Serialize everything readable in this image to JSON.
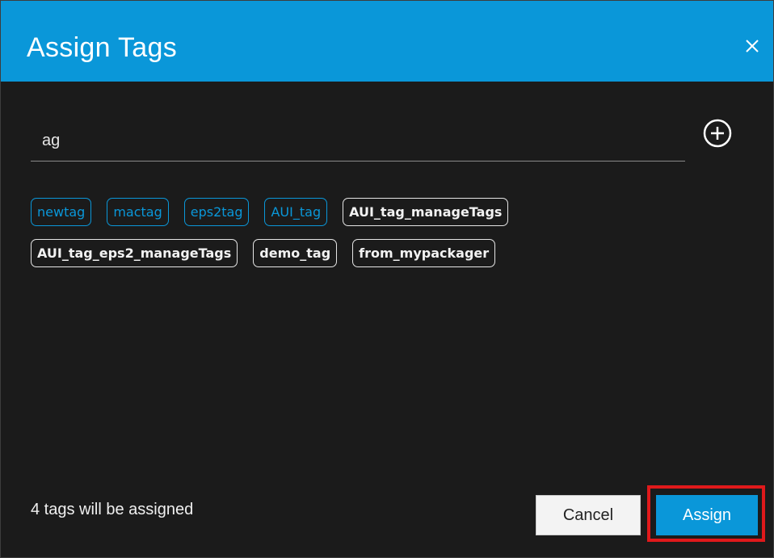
{
  "dialog": {
    "title": "Assign Tags",
    "close_icon": "close-icon"
  },
  "search": {
    "value": "ag",
    "add_icon": "plus-circle-icon"
  },
  "tags": {
    "row1": [
      {
        "label": "newtag",
        "selected": true
      },
      {
        "label": "mactag",
        "selected": true
      },
      {
        "label": "eps2tag",
        "selected": true
      },
      {
        "label": "AUI_tag",
        "selected": true
      },
      {
        "label": "AUI_tag_manageTags",
        "selected": false
      }
    ],
    "row2": [
      {
        "label": "AUI_tag_eps2_manageTags",
        "selected": false
      },
      {
        "label": "demo_tag",
        "selected": false
      },
      {
        "label": "from_mypackager",
        "selected": false
      }
    ]
  },
  "footer": {
    "status": "4 tags will be assigned",
    "cancel_label": "Cancel",
    "assign_label": "Assign"
  },
  "colors": {
    "accent": "#0a97d9",
    "background": "#1b1b1b",
    "highlight": "#e0191b"
  }
}
